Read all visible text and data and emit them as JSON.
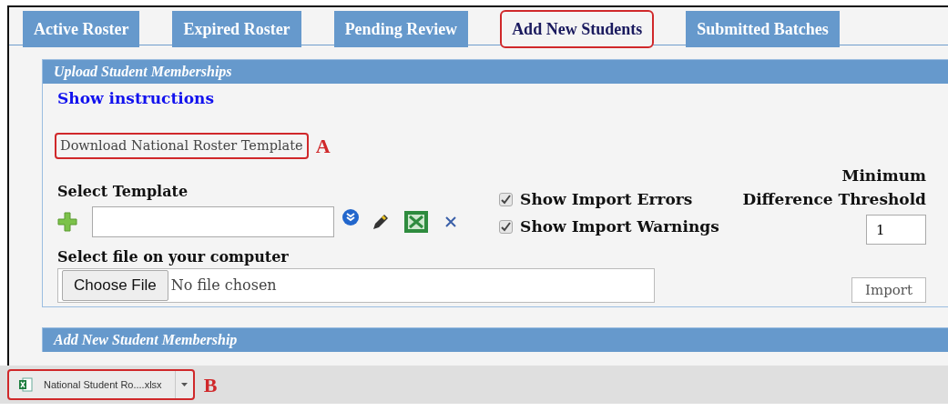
{
  "tabs": [
    {
      "label": "Active Roster",
      "selected": false,
      "highlighted": false
    },
    {
      "label": "Expired Roster",
      "selected": false,
      "highlighted": false
    },
    {
      "label": "Pending Review",
      "selected": false,
      "highlighted": false
    },
    {
      "label": "Add New Students",
      "selected": true,
      "highlighted": true
    },
    {
      "label": "Submitted Batches",
      "selected": false,
      "highlighted": false
    }
  ],
  "upload_panel": {
    "title": "Upload Student Memberships",
    "instructions_link": "Show instructions",
    "template_link": {
      "label": "Download National Roster Template",
      "highlighted": true,
      "callout": "A"
    },
    "select_template": {
      "label": "Select Template"
    },
    "options": [
      {
        "label": "Show Import Errors",
        "checked": true
      },
      {
        "label": "Show Import Warnings",
        "checked": true
      }
    ],
    "threshold": {
      "label_lines": [
        "Minimum",
        "Difference Threshold"
      ],
      "value": "1"
    },
    "file": {
      "label": "Select file on your computer",
      "button": "Choose File",
      "status": "No file chosen"
    },
    "import_button": "Import"
  },
  "add_panel": {
    "title": "Add New Student Membership"
  },
  "download_bar": {
    "file_name": "National Student Ro....xlsx",
    "highlighted": true,
    "callout": "B"
  }
}
